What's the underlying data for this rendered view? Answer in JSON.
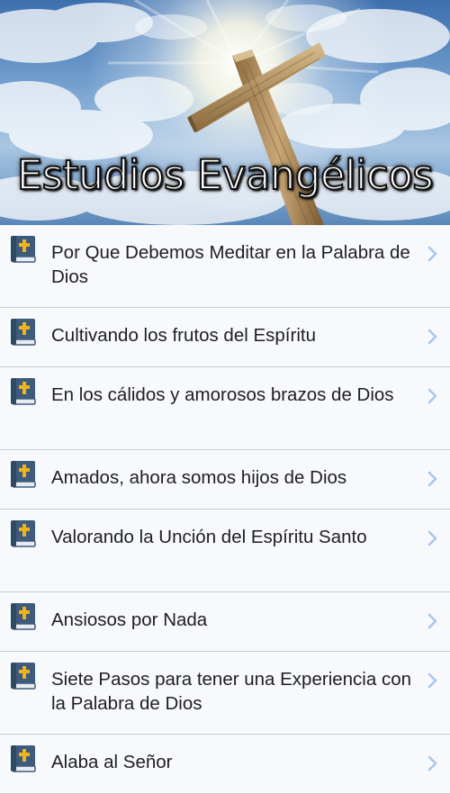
{
  "header": {
    "title": "Estudios Evangélicos"
  },
  "list": {
    "items": [
      {
        "label": "Por Que Debemos Meditar en la Palabra de Dios"
      },
      {
        "label": "Cultivando los frutos del Espíritu"
      },
      {
        "label": "En los cálidos y amorosos brazos de Dios"
      },
      {
        "label": "Amados, ahora somos hijos de Dios"
      },
      {
        "label": "Valorando la Unción del Espíritu Santo"
      },
      {
        "label": "Ansiosos por Nada"
      },
      {
        "label": "Siete Pasos para tener una Experiencia con la Palabra de Dios"
      },
      {
        "label": "Alaba al Señor"
      }
    ]
  },
  "icons": {
    "item_icon": "bible-book-icon",
    "item_chevron": "chevron-right-icon"
  },
  "colors": {
    "book_cover": "#3e5b7c",
    "book_cross": "#f2b21a",
    "chevron": "#a9c6ee"
  }
}
